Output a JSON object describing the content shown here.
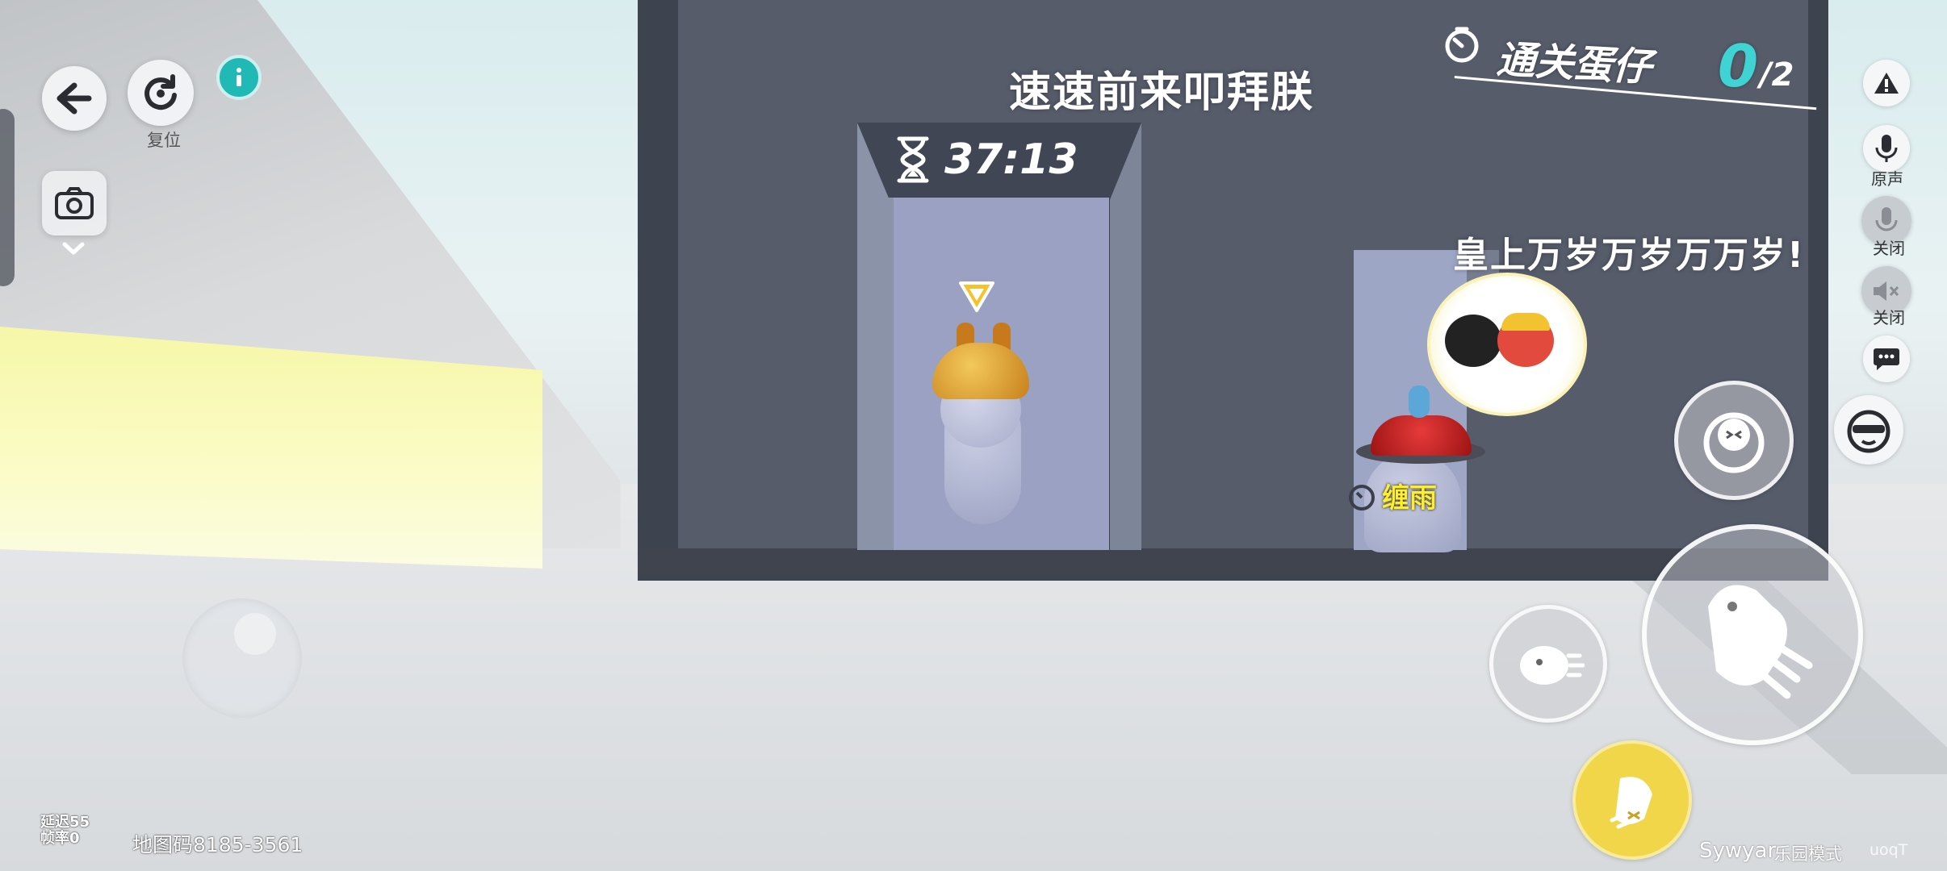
{
  "hud": {
    "reset_label": "复位",
    "objective": {
      "label": "通关蛋仔",
      "count": "0",
      "total": "/2"
    },
    "timer": "37:13",
    "right_controls": {
      "mic_label": "原声",
      "mute_label": "关闭",
      "speaker_label": "关闭"
    },
    "bottom": {
      "latency_label": "延迟55",
      "fps_label": "帧率0",
      "map_code": "地图码8185-3561",
      "brand": "Sywyar",
      "mode": "乐园模式",
      "uid": "uoqT"
    }
  },
  "scene": {
    "wall_text_top": "速速前来叩拜朕",
    "wall_text_right": "皇上万岁万岁万万岁!",
    "player_name": "缠雨"
  },
  "icons": {
    "back": "back-arrow-icon",
    "reset": "reset-icon",
    "info": "info-icon",
    "camera": "camera-icon",
    "warning": "warning-icon",
    "mic": "mic-icon",
    "chat": "chat-icon",
    "emote": "sunglasses-face-icon",
    "objective": "stopwatch-icon",
    "timer": "hourglass-icon"
  },
  "colors": {
    "objective_count": "#3fd3d4",
    "player_name": "#ffef2a",
    "dash_button": "#f2d64a",
    "info_button": "#21b9b6"
  }
}
